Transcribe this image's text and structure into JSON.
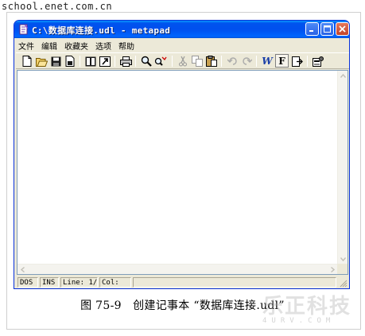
{
  "page_watermark": "school.enet.com.cn",
  "window": {
    "title": "C:\\数据库连接.udl - metapad",
    "controls": {
      "minimize_icon": "minimize-icon",
      "maximize_icon": "maximize-icon",
      "close_icon": "close-icon"
    }
  },
  "menu": {
    "items": [
      {
        "label": "文件"
      },
      {
        "label": "编辑"
      },
      {
        "label": "收藏夹"
      },
      {
        "label": "选项"
      },
      {
        "label": "帮助"
      }
    ]
  },
  "toolbar": {
    "buttons": [
      {
        "icon": "new-file-icon"
      },
      {
        "icon": "open-folder-icon"
      },
      {
        "icon": "save-icon"
      },
      {
        "icon": "save-as-icon"
      },
      {
        "icon": "print-preview-icon"
      },
      {
        "icon": "external-viewer-icon"
      },
      {
        "icon": "print-icon"
      },
      {
        "icon": "find-icon"
      },
      {
        "icon": "replace-icon"
      },
      {
        "icon": "cut-icon"
      },
      {
        "icon": "copy-icon"
      },
      {
        "icon": "paste-icon"
      },
      {
        "icon": "undo-icon"
      },
      {
        "icon": "redo-icon"
      },
      {
        "icon": "word-wrap-icon",
        "text": "W"
      },
      {
        "icon": "font-icon",
        "text": "F"
      },
      {
        "icon": "transparent-mode-icon"
      },
      {
        "icon": "settings-icon"
      }
    ]
  },
  "editor": {
    "content": ""
  },
  "status": {
    "mode": "DOS",
    "insert": "INS",
    "line": "Line: 1/",
    "col": "Col:"
  },
  "caption": "图 75-9　创建记事本 “数据库连接.udl”",
  "logo_watermark": {
    "text": "乐正科技",
    "sub": "4URV.COM"
  },
  "colors": {
    "titlebar": "#0054e3",
    "face": "#ece9d8",
    "editor_border": "#7f9db9",
    "close_button": "#c3442a"
  }
}
